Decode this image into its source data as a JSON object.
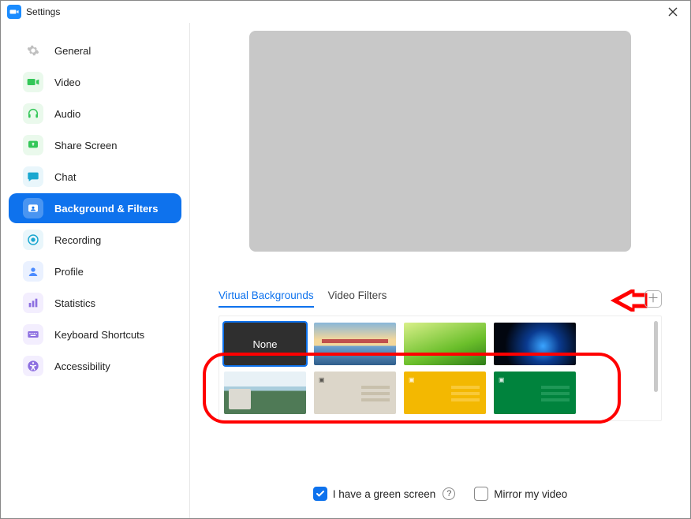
{
  "window": {
    "title": "Settings"
  },
  "sidebar": {
    "items": [
      {
        "id": "general",
        "label": "General",
        "iconBg": "#e8e8e8",
        "iconFg": "#bfbfbf"
      },
      {
        "id": "video",
        "label": "Video",
        "iconBg": "#eaf9ec",
        "iconFg": "#34c759"
      },
      {
        "id": "audio",
        "label": "Audio",
        "iconBg": "#eaf9ec",
        "iconFg": "#34c759"
      },
      {
        "id": "share",
        "label": "Share Screen",
        "iconBg": "#eaf9ec",
        "iconFg": "#34c759"
      },
      {
        "id": "chat",
        "label": "Chat",
        "iconBg": "#e9f6fb",
        "iconFg": "#1aa7d0"
      },
      {
        "id": "bgfilters",
        "label": "Background & Filters",
        "iconBg": "#ffffff",
        "iconFg": "#ffffff"
      },
      {
        "id": "recording",
        "label": "Recording",
        "iconBg": "#e9f6fb",
        "iconFg": "#1aa7d0"
      },
      {
        "id": "profile",
        "label": "Profile",
        "iconBg": "#eaf1ff",
        "iconFg": "#4b8bff"
      },
      {
        "id": "statistics",
        "label": "Statistics",
        "iconBg": "#f3eefe",
        "iconFg": "#8d6fe0"
      },
      {
        "id": "shortcuts",
        "label": "Keyboard Shortcuts",
        "iconBg": "#f3eefe",
        "iconFg": "#8d6fe0"
      },
      {
        "id": "a11y",
        "label": "Accessibility",
        "iconBg": "#f3eefe",
        "iconFg": "#8d6fe0"
      }
    ],
    "activeId": "bgfilters"
  },
  "tabs": {
    "items": [
      {
        "id": "vb",
        "label": "Virtual Backgrounds"
      },
      {
        "id": "vf",
        "label": "Video Filters"
      }
    ],
    "activeId": "vb"
  },
  "thumbs": {
    "noneLabel": "None",
    "selectedId": "none"
  },
  "options": {
    "greenScreen": {
      "label": "I have a green screen",
      "checked": true
    },
    "mirror": {
      "label": "Mirror my video",
      "checked": false
    }
  }
}
